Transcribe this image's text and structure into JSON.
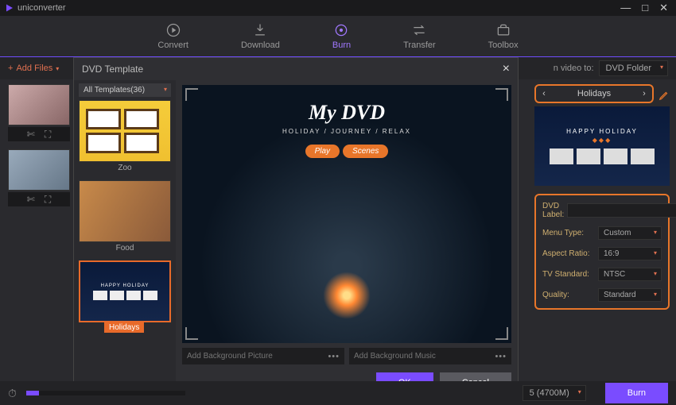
{
  "app": {
    "name": "uniconverter"
  },
  "window": {
    "minimize": "—",
    "maximize": "□",
    "close": "✕"
  },
  "nav": {
    "convert": "Convert",
    "download": "Download",
    "burn": "Burn",
    "transfer": "Transfer",
    "toolbox": "Toolbox"
  },
  "toolbar": {
    "add_files": "Add Files",
    "burn_to_label": "n video to:",
    "burn_to_value": "DVD Folder"
  },
  "panel": {
    "title": "DVD Template",
    "filter": "All Templates(36)",
    "templates": [
      {
        "name": "Zoo"
      },
      {
        "name": "Food"
      },
      {
        "name": "Holidays"
      }
    ],
    "preview": {
      "title": "My DVD",
      "subtitle": "HOLIDAY / JOURNEY / RELAX",
      "play": "Play",
      "scenes": "Scenes"
    },
    "bg_picture_placeholder": "Add Background Picture",
    "bg_music_placeholder": "Add Background Music",
    "ok": "OK",
    "cancel": "Cancel"
  },
  "right": {
    "template_name": "Holidays",
    "happy": "HAPPY HOLIDAY",
    "labels": {
      "dvd": "DVD Label:",
      "menu": "Menu Type:",
      "aspect": "Aspect Ratio:",
      "tv": "TV Standard:",
      "quality": "Quality:"
    },
    "values": {
      "menu": "Custom",
      "aspect": "16:9",
      "tv": "NTSC",
      "quality": "Standard"
    }
  },
  "bottom": {
    "capacity": "5 (4700M)",
    "burn": "Burn"
  }
}
